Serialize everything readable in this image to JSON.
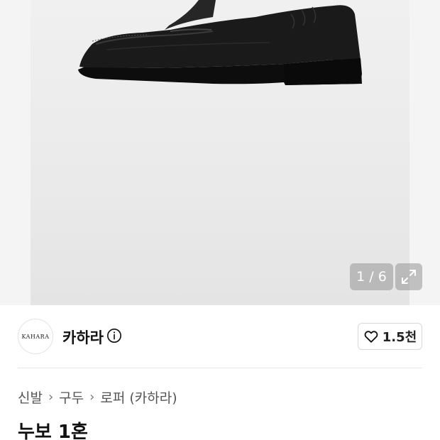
{
  "gallery": {
    "counter": "1 / 6",
    "expand_icon": "expand-icon"
  },
  "brand": {
    "logo_text": "KAHARA",
    "name": "카하라",
    "info_icon": "info-icon"
  },
  "like": {
    "icon": "heart-icon",
    "count": "1.5천"
  },
  "breadcrumb": {
    "items": [
      "신발",
      "구두",
      "로퍼 (카하라)"
    ]
  },
  "product": {
    "title": "누보 1혼"
  }
}
